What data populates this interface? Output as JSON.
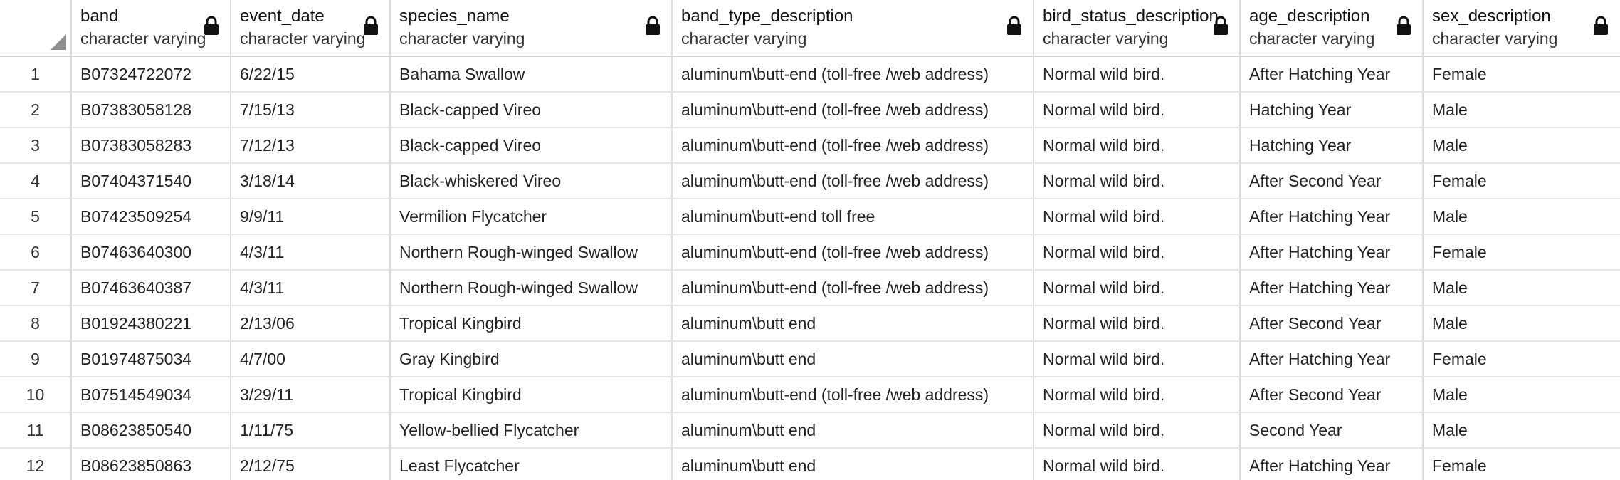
{
  "columns": [
    {
      "name": "band",
      "type": "character varying"
    },
    {
      "name": "event_date",
      "type": "character varying"
    },
    {
      "name": "species_name",
      "type": "character varying"
    },
    {
      "name": "band_type_description",
      "type": "character varying"
    },
    {
      "name": "bird_status_description",
      "type": "character varying"
    },
    {
      "name": "age_description",
      "type": "character varying"
    },
    {
      "name": "sex_description",
      "type": "character varying"
    }
  ],
  "rows": [
    {
      "num": "1",
      "band": "B07324722072",
      "event_date": "6/22/15",
      "species_name": "Bahama Swallow",
      "band_type_description": "aluminum\\butt-end (toll-free /web address)",
      "bird_status_description": "Normal wild bird.",
      "age_description": "After Hatching Year",
      "sex_description": "Female"
    },
    {
      "num": "2",
      "band": "B07383058128",
      "event_date": "7/15/13",
      "species_name": "Black-capped Vireo",
      "band_type_description": "aluminum\\butt-end (toll-free /web address)",
      "bird_status_description": "Normal wild bird.",
      "age_description": "Hatching Year",
      "sex_description": "Male"
    },
    {
      "num": "3",
      "band": "B07383058283",
      "event_date": "7/12/13",
      "species_name": "Black-capped Vireo",
      "band_type_description": "aluminum\\butt-end (toll-free /web address)",
      "bird_status_description": "Normal wild bird.",
      "age_description": "Hatching Year",
      "sex_description": "Male"
    },
    {
      "num": "4",
      "band": "B07404371540",
      "event_date": "3/18/14",
      "species_name": "Black-whiskered Vireo",
      "band_type_description": "aluminum\\butt-end (toll-free /web address)",
      "bird_status_description": "Normal wild bird.",
      "age_description": "After Second Year",
      "sex_description": "Female"
    },
    {
      "num": "5",
      "band": "B07423509254",
      "event_date": "9/9/11",
      "species_name": "Vermilion Flycatcher",
      "band_type_description": "aluminum\\butt-end toll free",
      "bird_status_description": "Normal wild bird.",
      "age_description": "After Hatching Year",
      "sex_description": "Male"
    },
    {
      "num": "6",
      "band": "B07463640300",
      "event_date": "4/3/11",
      "species_name": "Northern Rough-winged Swallow",
      "band_type_description": "aluminum\\butt-end (toll-free /web address)",
      "bird_status_description": "Normal wild bird.",
      "age_description": "After Hatching Year",
      "sex_description": "Female"
    },
    {
      "num": "7",
      "band": "B07463640387",
      "event_date": "4/3/11",
      "species_name": "Northern Rough-winged Swallow",
      "band_type_description": "aluminum\\butt-end (toll-free /web address)",
      "bird_status_description": "Normal wild bird.",
      "age_description": "After Hatching Year",
      "sex_description": "Male"
    },
    {
      "num": "8",
      "band": "B01924380221",
      "event_date": "2/13/06",
      "species_name": "Tropical Kingbird",
      "band_type_description": "aluminum\\butt end",
      "bird_status_description": "Normal wild bird.",
      "age_description": "After Second Year",
      "sex_description": "Male"
    },
    {
      "num": "9",
      "band": "B01974875034",
      "event_date": "4/7/00",
      "species_name": "Gray Kingbird",
      "band_type_description": "aluminum\\butt end",
      "bird_status_description": "Normal wild bird.",
      "age_description": "After Hatching Year",
      "sex_description": "Female"
    },
    {
      "num": "10",
      "band": "B07514549034",
      "event_date": "3/29/11",
      "species_name": "Tropical Kingbird",
      "band_type_description": "aluminum\\butt-end (toll-free /web address)",
      "bird_status_description": "Normal wild bird.",
      "age_description": "After Second Year",
      "sex_description": "Male"
    },
    {
      "num": "11",
      "band": "B08623850540",
      "event_date": "1/11/75",
      "species_name": "Yellow-bellied Flycatcher",
      "band_type_description": "aluminum\\butt end",
      "bird_status_description": "Normal wild bird.",
      "age_description": "Second Year",
      "sex_description": "Male"
    },
    {
      "num": "12",
      "band": "B08623850863",
      "event_date": "2/12/75",
      "species_name": "Least Flycatcher",
      "band_type_description": "aluminum\\butt end",
      "bird_status_description": "Normal wild bird.",
      "age_description": "After Hatching Year",
      "sex_description": "Female"
    }
  ],
  "icons": {
    "lock": "lock-icon",
    "select_all": "select-all-corner-icon"
  }
}
